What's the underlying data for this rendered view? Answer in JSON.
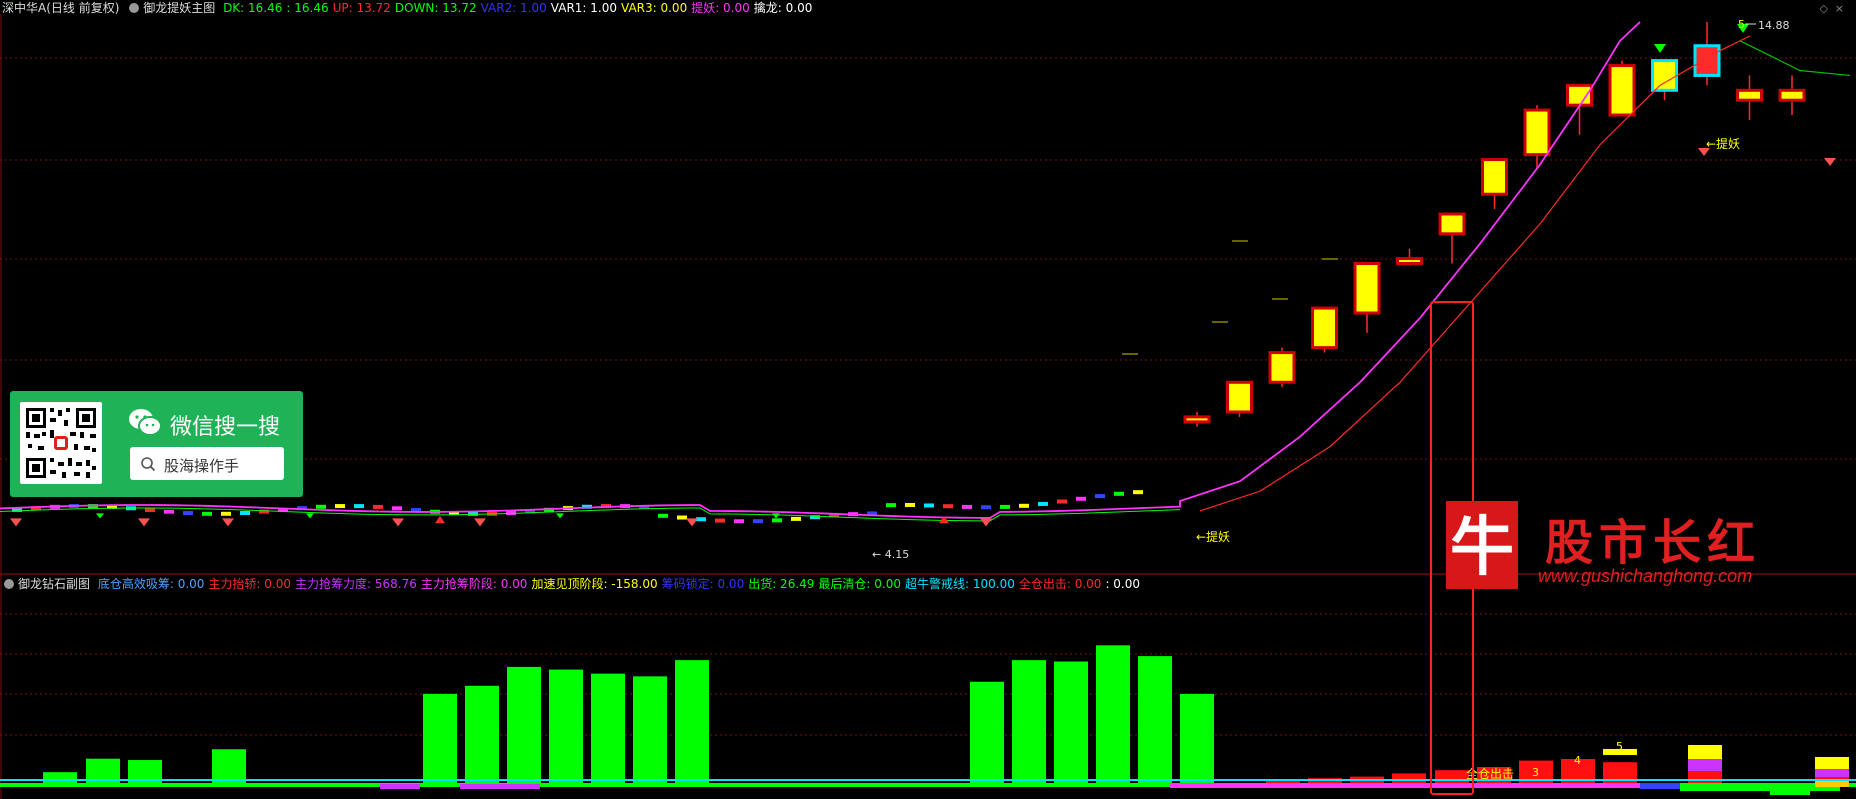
{
  "header": {
    "stock": "深中华A(日线 前复权)",
    "indicator": "御龙提妖主图",
    "items": [
      {
        "label": "DK: 16.46",
        "color": "#00ff00"
      },
      {
        "label": ": 16.46",
        "color": "#00ff00"
      },
      {
        "label": "UP: 13.72",
        "color": "#ff2a2a"
      },
      {
        "label": "DOWN: 13.72",
        "color": "#00ff00"
      },
      {
        "label": "VAR2: 1.00",
        "color": "#3333ff"
      },
      {
        "label": "VAR1: 1.00",
        "color": "#ffffff"
      },
      {
        "label": "VAR3: 0.00",
        "color": "#ffff00"
      },
      {
        "label": "提妖: 0.00",
        "color": "#ff33ff"
      },
      {
        "label": "擒龙: 0.00",
        "color": "#ffffff"
      }
    ]
  },
  "sub_header": {
    "indicator": "御龙钻石副图",
    "items": [
      {
        "label": "底仓高效吸筹: 0.00",
        "color": "#4aa3ff"
      },
      {
        "label": "主力抬轿: 0.00",
        "color": "#ff2a2a"
      },
      {
        "label": "主力抢筹力度: 568.76",
        "color": "#cc33ff"
      },
      {
        "label": "主力抢筹阶段: 0.00",
        "color": "#ff33ff"
      },
      {
        "label": "加速见顶阶段: -158.00",
        "color": "#ffff00"
      },
      {
        "label": "筹码锁定: 0.00",
        "color": "#3333ff"
      },
      {
        "label": "出货: 26.49",
        "color": "#00ff00"
      },
      {
        "label": "最后清仓: 0.00",
        "color": "#00ff00"
      },
      {
        "label": "超牛警戒线: 100.00",
        "color": "#00e5ff"
      },
      {
        "label": "全仓出击: 0.00",
        "color": "#ff2a2a"
      },
      {
        "label": ": 0.00",
        "color": "#ffffff"
      }
    ]
  },
  "wechat": {
    "title": "微信搜一搜",
    "search": "股海操作手"
  },
  "brand": {
    "name": "股市长红",
    "url": "www.gushichanghong.com"
  },
  "chart_data": [
    {
      "type": "candlestick",
      "title": "御龙提妖主图",
      "annotations": [
        {
          "text": "14.88",
          "note": "high"
        },
        {
          "text": "4.15",
          "note": "low"
        },
        {
          "text": "提妖"
        },
        {
          "text": "提妖"
        }
      ],
      "candles": [
        {
          "o": 6.8,
          "h": 7.0,
          "l": 6.7,
          "c": 6.9
        },
        {
          "o": 7.0,
          "h": 7.6,
          "l": 6.9,
          "c": 7.6
        },
        {
          "o": 7.6,
          "h": 8.3,
          "l": 7.5,
          "c": 8.2
        },
        {
          "o": 8.3,
          "h": 9.1,
          "l": 8.2,
          "c": 9.1
        },
        {
          "o": 9.0,
          "h": 10.0,
          "l": 8.6,
          "c": 10.0
        },
        {
          "o": 10.0,
          "h": 10.3,
          "l": 10.0,
          "c": 10.1
        },
        {
          "o": 10.6,
          "h": 11.0,
          "l": 10.0,
          "c": 11.0
        },
        {
          "o": 11.4,
          "h": 12.1,
          "l": 11.1,
          "c": 12.1
        },
        {
          "o": 12.2,
          "h": 13.2,
          "l": 11.9,
          "c": 13.1
        },
        {
          "o": 13.2,
          "h": 13.6,
          "l": 12.6,
          "c": 13.6
        },
        {
          "o": 14.0,
          "h": 14.1,
          "l": 13.0,
          "c": 13.0
        },
        {
          "o": 13.5,
          "h": 14.1,
          "l": 13.3,
          "c": 14.1
        },
        {
          "o": 14.4,
          "h": 14.88,
          "l": 13.6,
          "c": 13.8
        },
        {
          "o": 13.5,
          "h": 13.8,
          "l": 12.9,
          "c": 13.3
        },
        {
          "o": 13.5,
          "h": 13.8,
          "l": 13.0,
          "c": 13.3
        }
      ]
    },
    {
      "type": "bar",
      "title": "御龙钻石副图",
      "green_values": [
        8,
        18,
        17,
        25,
        66,
        72,
        86,
        84,
        81,
        79,
        91,
        75,
        91,
        90,
        102,
        94,
        66
      ],
      "red_values": [
        2,
        3,
        4,
        6,
        8,
        10,
        14,
        15,
        13,
        18
      ],
      "labels": [
        "全仓出击",
        "3",
        "4",
        "5"
      ]
    }
  ]
}
